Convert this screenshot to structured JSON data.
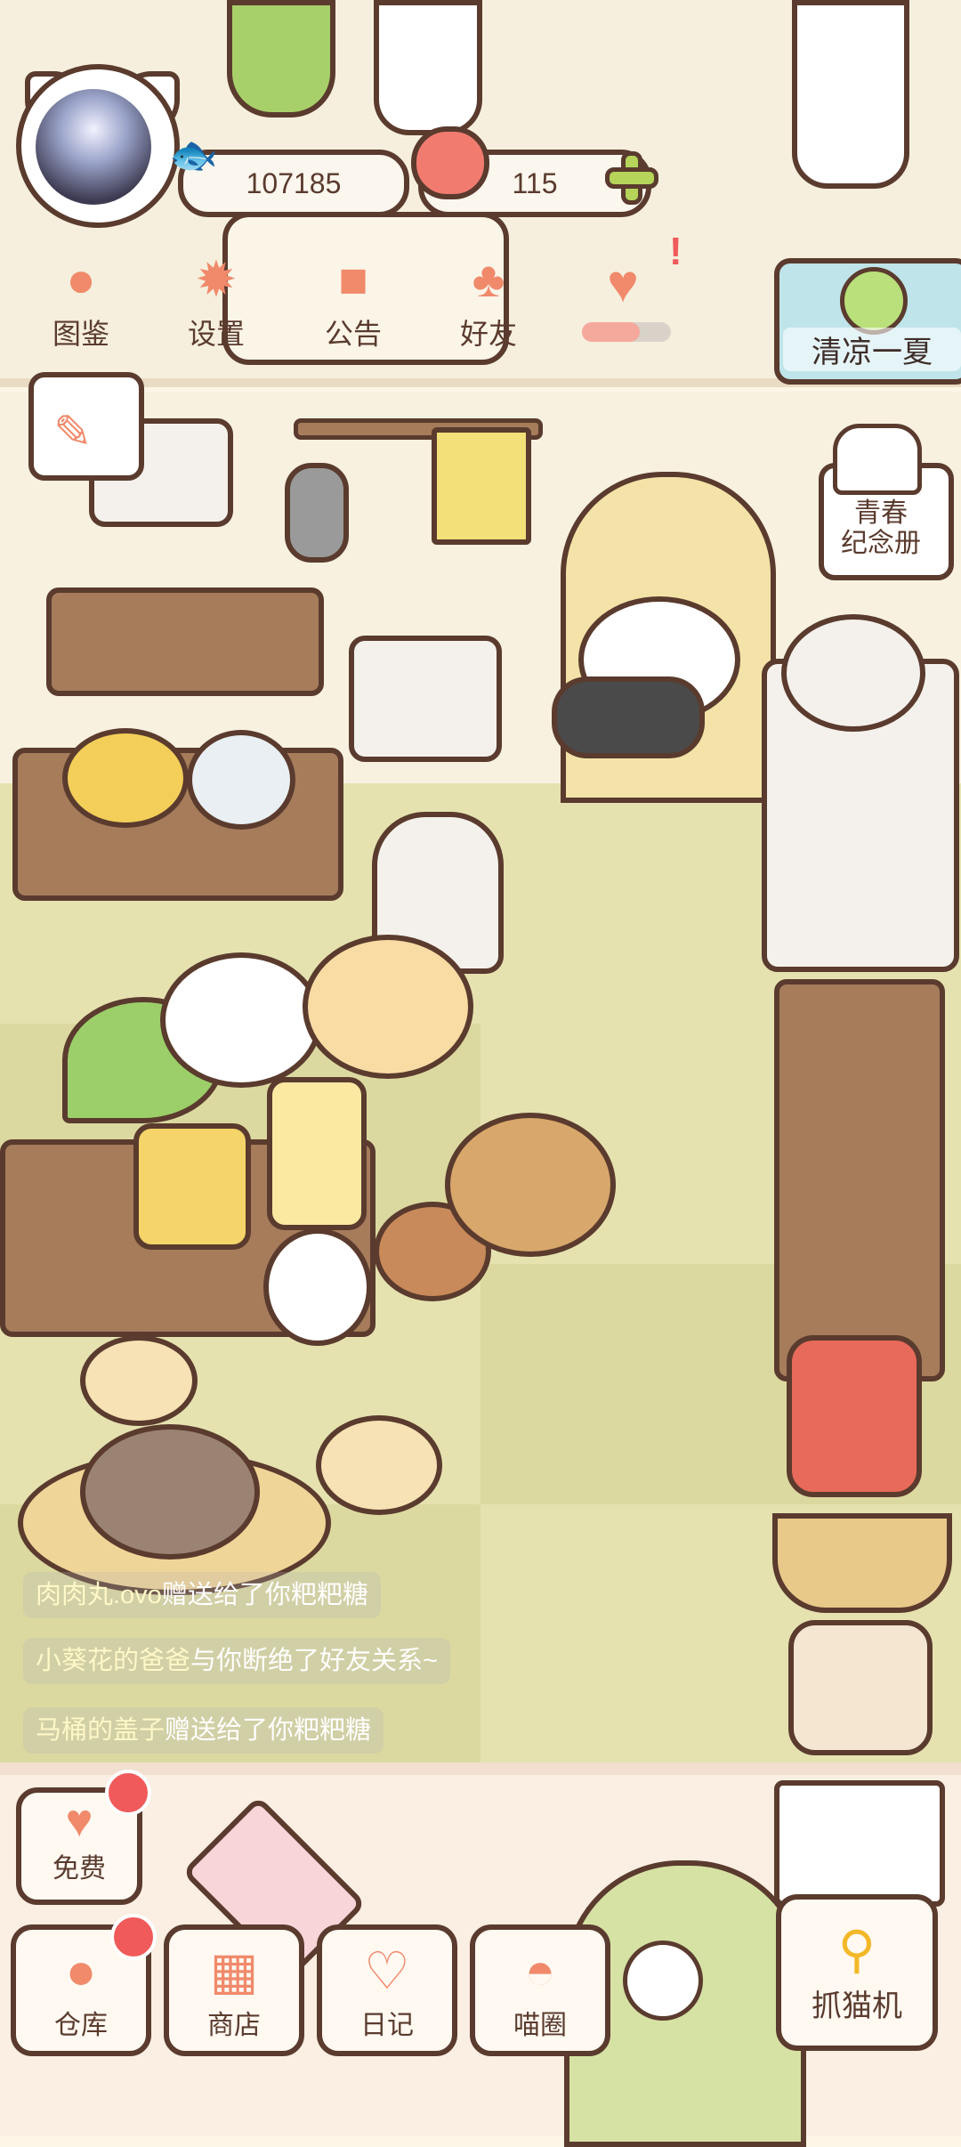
{
  "header": {
    "coins": "107185",
    "hearts": "115"
  },
  "menu": [
    {
      "label": "图鉴",
      "icon": "cat-head-icon"
    },
    {
      "label": "设置",
      "icon": "gear-icon"
    },
    {
      "label": "公告",
      "icon": "gift-icon"
    },
    {
      "label": "好友",
      "icon": "friends-icon"
    }
  ],
  "event": {
    "label": "清凉一夏"
  },
  "album": {
    "label_line1": "青春",
    "label_line2": "纪念册"
  },
  "chat": [
    {
      "name": "肉肉丸.ovo",
      "text": "赠送给了你粑粑糖"
    },
    {
      "name": "小葵花的爸爸",
      "text": "与你断绝了好友关系~"
    },
    {
      "name": "马桶的盖子",
      "text": "赠送给了你粑粑糖"
    }
  ],
  "bottom_buttons": {
    "free": "免费",
    "warehouse": "仓库",
    "shop": "商店",
    "diary": "日记",
    "circle": "喵圈",
    "claw": "抓猫机"
  },
  "colors": {
    "accent": "#f08a6b",
    "outline": "#5a3b2e",
    "badge": "#f05a5a",
    "floor": "#e5e2b0"
  }
}
